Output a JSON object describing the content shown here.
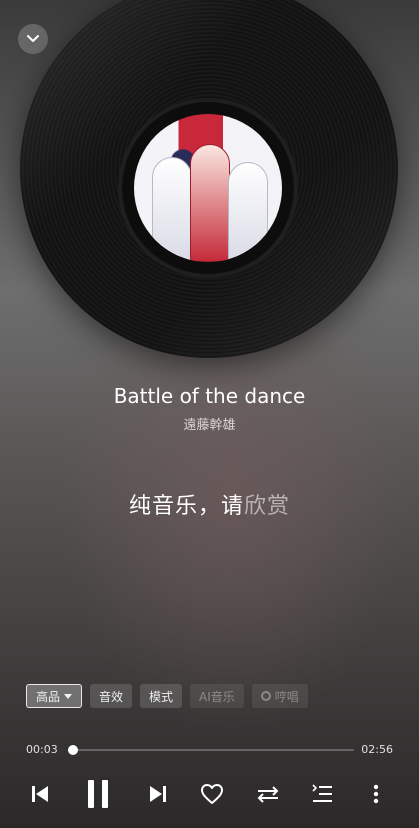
{
  "header": {
    "collapse_icon": "chevron-down-icon"
  },
  "track": {
    "title": "Battle of the dance",
    "artist": "遠藤幹雄"
  },
  "lyric": {
    "main": "纯音乐，请",
    "dim": "欣赏"
  },
  "chips": [
    {
      "label": "高品",
      "state": "selected"
    },
    {
      "label": "音效",
      "state": "normal"
    },
    {
      "label": "模式",
      "state": "normal"
    },
    {
      "label": "AI音乐",
      "state": "disabled"
    },
    {
      "label": "哼唱",
      "state": "disabled"
    }
  ],
  "playback": {
    "current_time": "00:03",
    "total_time": "02:56",
    "progress_fraction": 0.017
  },
  "controls": {
    "previous": "previous-icon",
    "play_pause": "pause-icon",
    "next": "next-icon",
    "like": "heart-icon",
    "shuffle": "shuffle-icon",
    "playlist": "playlist-icon",
    "more": "more-vertical-icon"
  }
}
